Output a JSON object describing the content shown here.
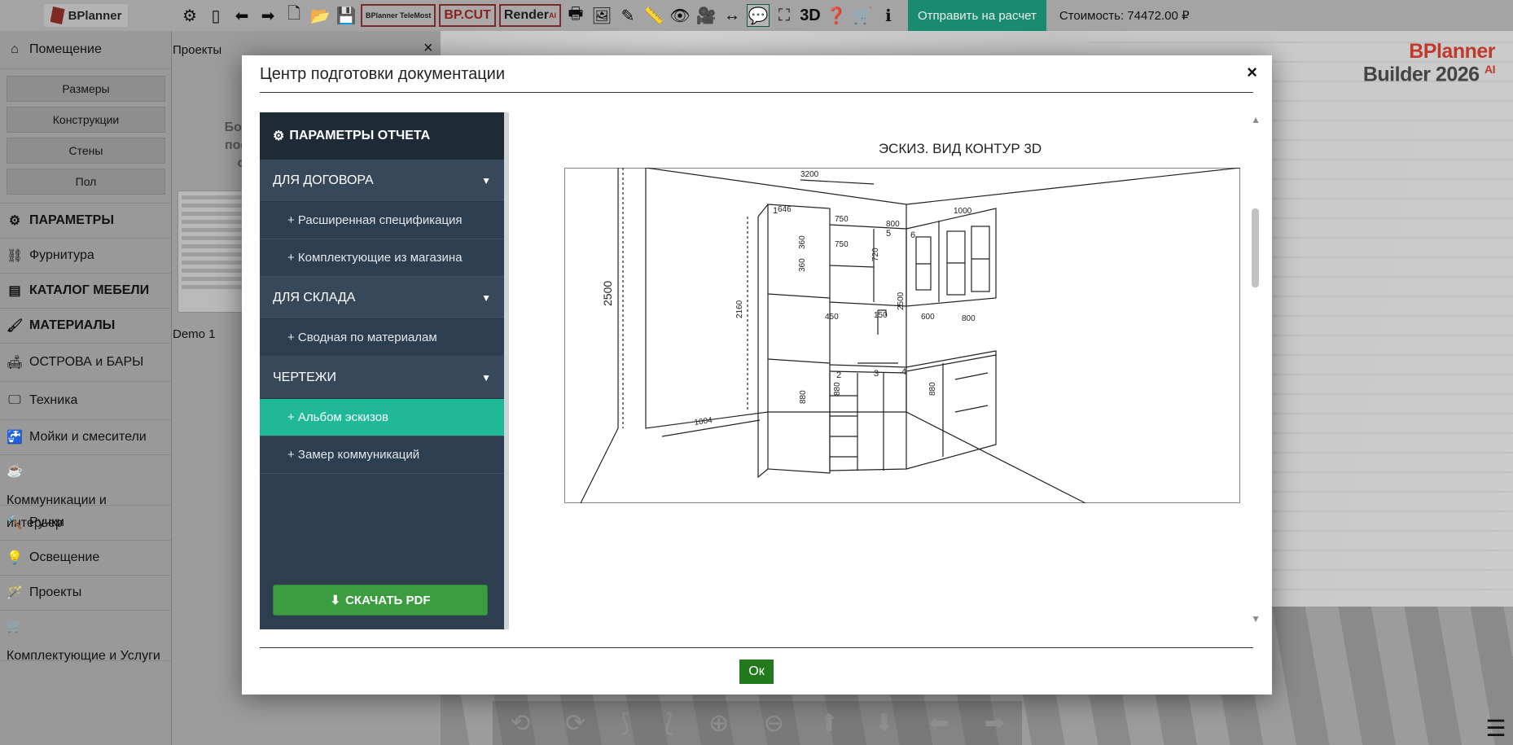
{
  "app": {
    "logo": "BPlanner"
  },
  "toolbar": {
    "badges": [
      "BPlanner TeleMost",
      "BP.CUT",
      "Render"
    ],
    "badge_super": "AI",
    "three_d_label": "3D",
    "send_button": "Отправить на расчет",
    "cost": "Стоимость: 74472.00 ₽"
  },
  "brand": {
    "line1": "BPlanner",
    "line2": "Builder 2026",
    "sup": "AI"
  },
  "sidebar": {
    "room": "Помещение",
    "room_buttons": [
      "Размеры",
      "Конструкции",
      "Стены",
      "Пол"
    ],
    "items": [
      "ПАРАМЕТРЫ",
      "Фурнитура",
      "КАТАЛОГ МЕБЕЛИ",
      "МАТЕРИАЛЫ",
      "ОСТРОВА и БАРЫ",
      "Техника",
      "Мойки и смесители",
      "Коммуникации и интерьер",
      "Ручки",
      "Освещение",
      "Проекты",
      "Комплектующие и Услуги"
    ]
  },
  "projects": {
    "header": "Проекты",
    "close": "×",
    "hint": "Боль\nпосм\nс",
    "demo": "Demo 1"
  },
  "modal": {
    "title": "Центр подготовки документации",
    "close": "×",
    "ok": "Ок",
    "menu": {
      "header": "ПАРАМЕТРЫ ОТЧЕТА",
      "sections": [
        {
          "label": "ДЛЯ ДОГОВОРА",
          "items": [
            "+ Расширенная спецификация",
            "+ Комплектующие из магазина"
          ]
        },
        {
          "label": "ДЛЯ СКЛАДА",
          "items": [
            "+ Сводная по материалам"
          ]
        },
        {
          "label": "ЧЕРТЕЖИ",
          "items": [
            "+ Альбом эскизов",
            "+ Замер коммуникаций"
          ]
        }
      ],
      "active_item": "+ Альбом эскизов",
      "download": "СКАЧАТЬ PDF"
    },
    "preview": {
      "title": "ЭСКИЗ. ВИД КОНТУР 3D",
      "dimensions": [
        "3200",
        "2500",
        "2160",
        "1004",
        "646",
        "750",
        "750",
        "360",
        "360",
        "720",
        "800",
        "1000",
        "2500",
        "450",
        "150",
        "600",
        "800",
        "880",
        "880",
        "880"
      ],
      "labels": [
        "1",
        "2",
        "3",
        "4",
        "5",
        "6"
      ]
    }
  }
}
